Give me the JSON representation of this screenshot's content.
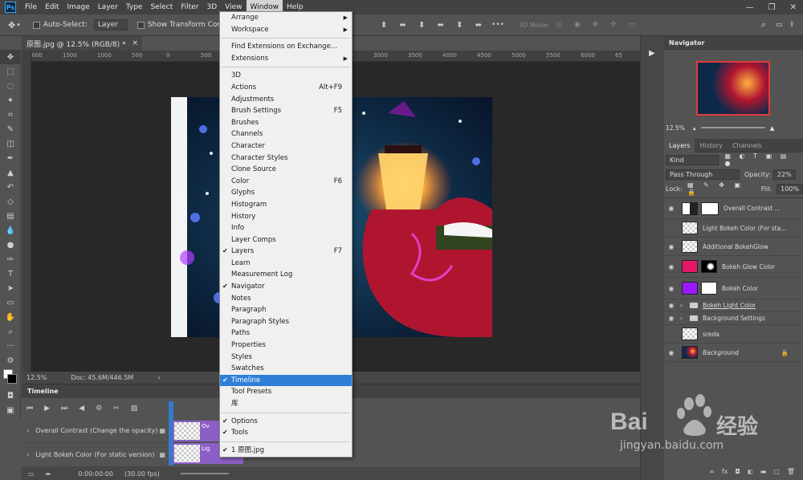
{
  "menubar": {
    "logo": "Ps",
    "items": [
      "File",
      "Edit",
      "Image",
      "Layer",
      "Type",
      "Select",
      "Filter",
      "3D",
      "View",
      "Window",
      "Help"
    ],
    "active": "Window"
  },
  "options": {
    "auto_select_label": "Auto-Select:",
    "auto_select_value": "Layer",
    "transform_label": "Show Transform Controls",
    "mode_3d": "3D Mode:"
  },
  "document": {
    "tab_label": "原图.jpg @ 12.5% (RGB/8) *",
    "ruler_ticks": [
      "2000",
      "1500",
      "1000",
      "500",
      "0",
      "500",
      "1000",
      "1500",
      "2000",
      "2500",
      "3000",
      "3500",
      "4000",
      "4500",
      "5000",
      "5500",
      "6000",
      "65"
    ],
    "zoom": "12.5%",
    "doc_info": "Doc: 45.6M/446.5M"
  },
  "timeline": {
    "title": "Timeline",
    "rows": [
      {
        "label": "Overall Contrast (Change the opacity)",
        "clip": "Ov"
      },
      {
        "label": "Light Bokeh Color (For static version)",
        "clip": "Lig"
      }
    ],
    "timecode": "0:00:00:00",
    "fps": "(30.00 fps)"
  },
  "window_menu": {
    "items": [
      {
        "label": "Arrange",
        "submenu": true
      },
      {
        "label": "Workspace",
        "submenu": true
      },
      {
        "sep": true
      },
      {
        "label": "Find Extensions on Exchange..."
      },
      {
        "label": "Extensions",
        "submenu": true
      },
      {
        "sep": true
      },
      {
        "label": "3D"
      },
      {
        "label": "Actions",
        "shortcut": "Alt+F9"
      },
      {
        "label": "Adjustments"
      },
      {
        "label": "Brush Settings",
        "shortcut": "F5"
      },
      {
        "label": "Brushes"
      },
      {
        "label": "Channels"
      },
      {
        "label": "Character"
      },
      {
        "label": "Character Styles"
      },
      {
        "label": "Clone Source"
      },
      {
        "label": "Color",
        "shortcut": "F6"
      },
      {
        "label": "Glyphs"
      },
      {
        "label": "Histogram"
      },
      {
        "label": "History"
      },
      {
        "label": "Info"
      },
      {
        "label": "Layer Comps"
      },
      {
        "label": "Layers",
        "shortcut": "F7",
        "checked": true
      },
      {
        "label": "Learn"
      },
      {
        "label": "Measurement Log"
      },
      {
        "label": "Navigator",
        "checked": true
      },
      {
        "label": "Notes"
      },
      {
        "label": "Paragraph"
      },
      {
        "label": "Paragraph Styles"
      },
      {
        "label": "Paths"
      },
      {
        "label": "Properties"
      },
      {
        "label": "Styles"
      },
      {
        "label": "Swatches"
      },
      {
        "label": "Timeline",
        "checked": true,
        "highlighted": true
      },
      {
        "label": "Tool Presets"
      },
      {
        "label": "库"
      },
      {
        "sep": true
      },
      {
        "label": "Options",
        "checked": true
      },
      {
        "label": "Tools",
        "checked": true
      },
      {
        "sep": true
      },
      {
        "label": "1 原图.jpg",
        "checked": true
      }
    ]
  },
  "navigator": {
    "title": "Navigator",
    "zoom": "12.5%"
  },
  "layers_panel": {
    "tabs": [
      "Layers",
      "History",
      "Channels"
    ],
    "kind": "Kind",
    "blend": "Pass Through",
    "opacity_label": "Opacity:",
    "opacity": "22%",
    "lock_label": "Lock:",
    "fill_label": "Fill:",
    "fill": "100%",
    "layers": [
      {
        "name": "Overall Contrast ...",
        "visible": true,
        "thumb": "gradient"
      },
      {
        "name": "Light Bokeh Color (For sta...",
        "visible": false,
        "thumb": "checker"
      },
      {
        "name": "Additional BokehGlow",
        "visible": true,
        "thumb": "checker"
      },
      {
        "name": "Bokeh Glow Color",
        "visible": true,
        "thumb": "pink"
      },
      {
        "name": "Bokeh Color",
        "visible": true,
        "thumb": "purple"
      },
      {
        "name": "Bokeh Light Color",
        "visible": true,
        "thumb": "folder"
      },
      {
        "name": "Background Settings",
        "visible": true,
        "thumb": "folder"
      },
      {
        "name": "sreda",
        "visible": false,
        "thumb": "checker"
      },
      {
        "name": "Background",
        "visible": true,
        "thumb": "photo"
      }
    ]
  },
  "watermark": {
    "brand": "Bai",
    "brand2": "经验",
    "url": "jingyan.baidu.com"
  },
  "colors": {
    "accent": "#2f7fd8",
    "ps_blue": "#31a8ff",
    "pink": "#e8176a",
    "purple": "#9b19ff"
  }
}
